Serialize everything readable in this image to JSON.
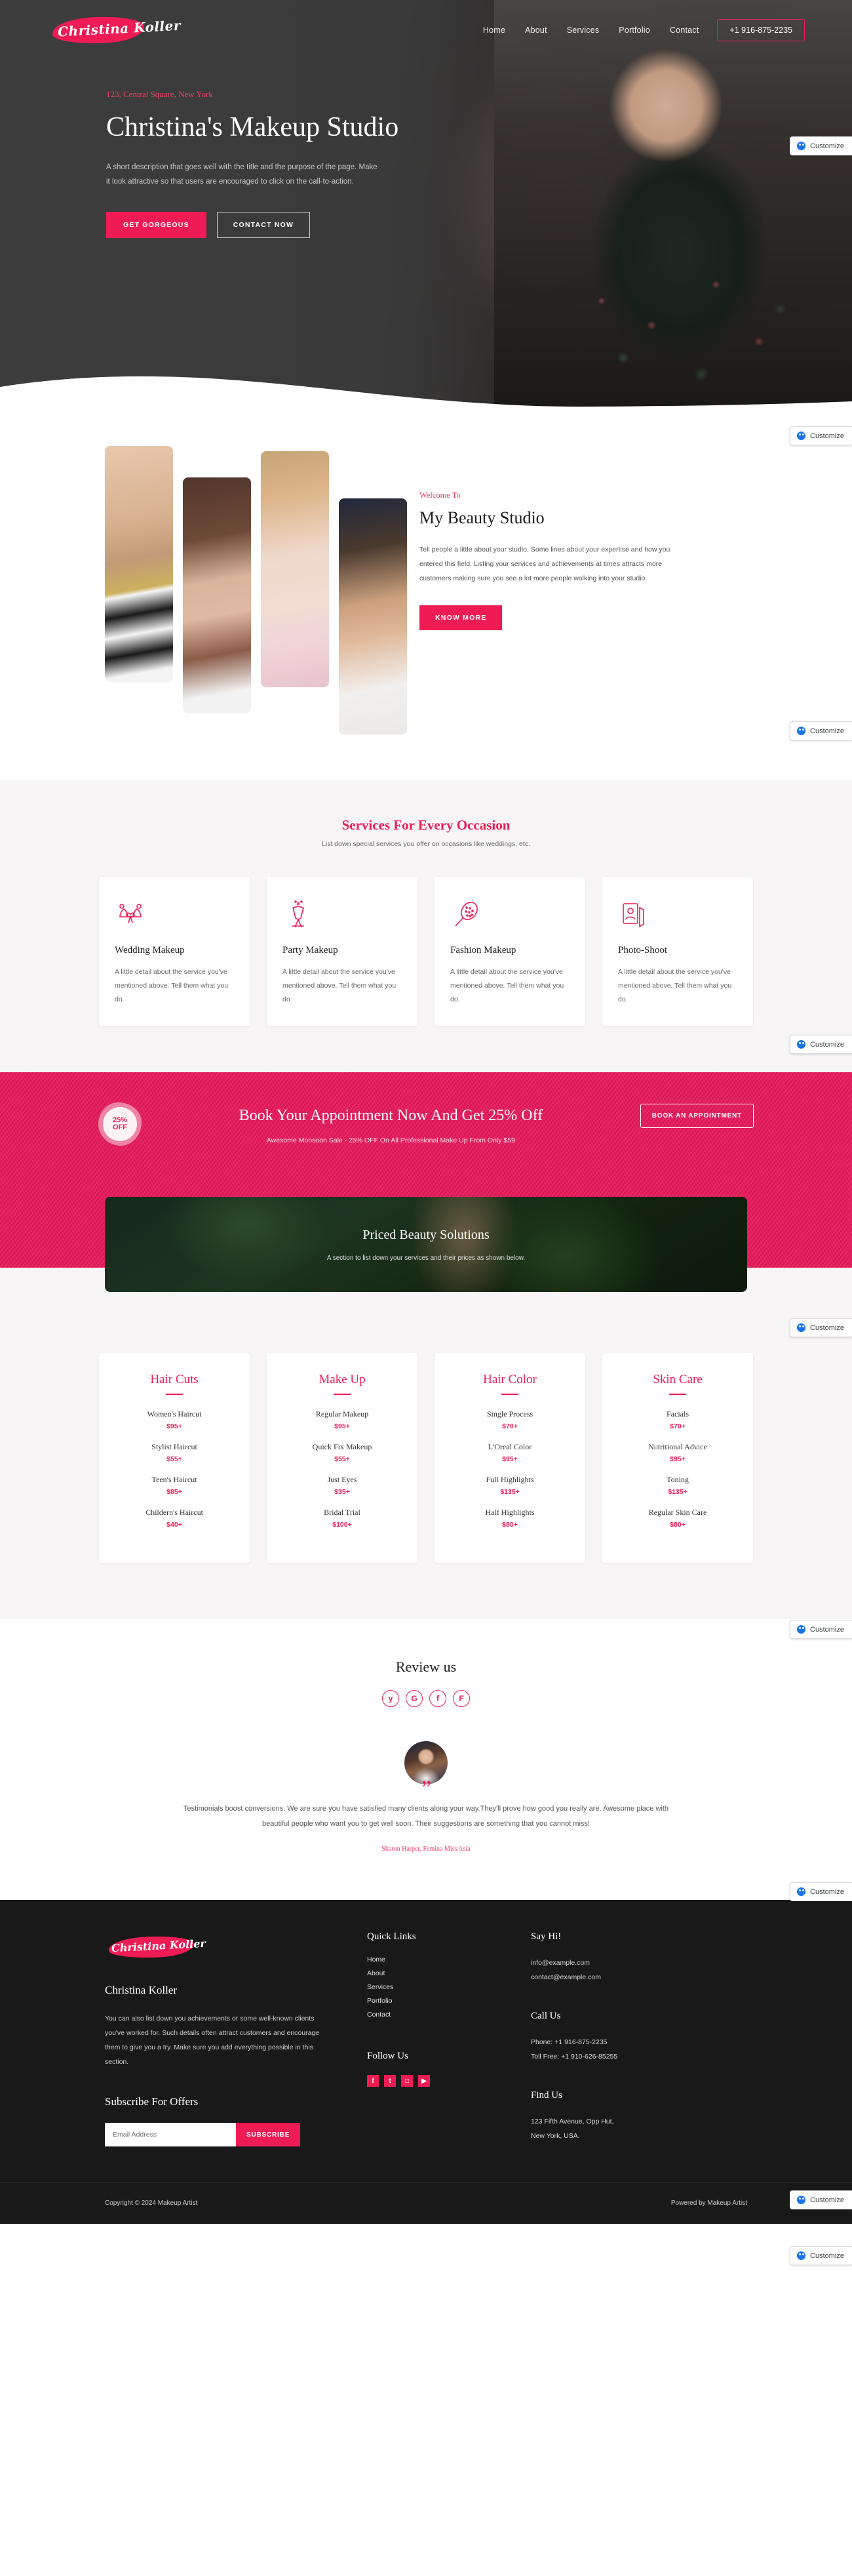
{
  "brand": {
    "logo_text": "Christina Koller"
  },
  "nav": {
    "links": [
      {
        "label": "Home"
      },
      {
        "label": "About"
      },
      {
        "label": "Services"
      },
      {
        "label": "Portfolio"
      },
      {
        "label": "Contact"
      }
    ],
    "phone": "+1 916-875-2235"
  },
  "hero": {
    "address": "123, Central Square, New York",
    "title": "Christina's Makeup Studio",
    "description": "A short description that goes well with the title and the purpose of the page. Make it look attractive so that users are encouraged to click on the call-to-action.",
    "primary_button": "GET GORGEOUS",
    "secondary_button": "CONTACT NOW"
  },
  "customize": {
    "label": "Customize"
  },
  "about": {
    "eyebrow": "Welcome To",
    "heading": "My Beauty Studio",
    "paragraph": "Tell people a little about your studio. Some lines about your expertise and how you entered this field. Listing your services and achievements at times attracts more customers making sure you see a lot more people walking into your studio.",
    "button": "KNOW MORE"
  },
  "services": {
    "title": "Services For Every Occasion",
    "subtitle": "List down special services you offer on occasions like weddings, etc.",
    "items": [
      {
        "icon": "wedding-bells-icon",
        "name": "Wedding Makeup",
        "desc": "A little detail about the service you've mentioned above. Tell them what you do."
      },
      {
        "icon": "champagne-glasses-icon",
        "name": "Party Makeup",
        "desc": "A little detail about the service you've mentioned above. Tell them what you do."
      },
      {
        "icon": "hair-brush-icon",
        "name": "Fashion Makeup",
        "desc": "A little detail about the service you've mentioned above. Tell them what you do."
      },
      {
        "icon": "photo-portrait-icon",
        "name": "Photo-Shoot",
        "desc": "A little detail about the service you've mentioned above. Tell them what you do."
      }
    ]
  },
  "booking": {
    "badge_top": "25%",
    "badge_bottom": "OFF",
    "heading": "Book Your Appointment Now And Get 25% Off",
    "subtext": "Awesome Monsoon Sale - 25% OFF On All Professional Make Up From Only $59",
    "button": "BOOK AN APPOINTMENT"
  },
  "price_hero": {
    "heading": "Priced Beauty Solutions",
    "subtext": "A section to list down your services and their prices as shown below."
  },
  "pricing": {
    "cards": [
      {
        "title": "Hair Cuts",
        "items": [
          {
            "name": "Women's Haircut",
            "price": "$95+"
          },
          {
            "name": "Stylist Haircut",
            "price": "$55+"
          },
          {
            "name": "Teen's Haircut",
            "price": "$85+"
          },
          {
            "name": "Childern's Haircut",
            "price": "$40+"
          }
        ]
      },
      {
        "title": "Make Up",
        "items": [
          {
            "name": "Regular Makeup",
            "price": "$95+"
          },
          {
            "name": "Quick Fix Makeup",
            "price": "$55+"
          },
          {
            "name": "Just Eyes",
            "price": "$35+"
          },
          {
            "name": "Bridal Trial",
            "price": "$100+"
          }
        ]
      },
      {
        "title": "Hair Color",
        "items": [
          {
            "name": "Single Process",
            "price": "$70+"
          },
          {
            "name": "L'Oreal Color",
            "price": "$95+"
          },
          {
            "name": "Full Highlights",
            "price": "$135+"
          },
          {
            "name": "Half Highlights",
            "price": "$80+"
          }
        ]
      },
      {
        "title": "Skin Care",
        "items": [
          {
            "name": "Facials",
            "price": "$70+"
          },
          {
            "name": "Nutritional Advice",
            "price": "$95+"
          },
          {
            "name": "Toning",
            "price": "$135+"
          },
          {
            "name": "Regular Skin Care",
            "price": "$80+"
          }
        ]
      }
    ]
  },
  "review": {
    "heading": "Review us",
    "socials": [
      {
        "icon": "yelp-icon",
        "glyph": "y"
      },
      {
        "icon": "google-icon",
        "glyph": "G"
      },
      {
        "icon": "facebook-icon",
        "glyph": "f"
      },
      {
        "icon": "foursquare-icon",
        "glyph": "F"
      }
    ],
    "quote_mark": "”",
    "testimonial": "Testimonials boost conversions. We are sure you have satisfied many clients along your way.They'll prove how good you really are. Awesome place with beautiful people who want you to get well soon. Their suggestions are something that you cannot miss!",
    "author": "Sharon Harper, Femina Miss Asia"
  },
  "footer": {
    "name": "Christina Koller",
    "about": "You can also list down you achievements or some well-known clients you've worked for. Such details often attract customers and encourage them to give you a try. Make sure you add everything possible in this section.",
    "subscribe_heading": "Subscribe For Offers",
    "email_placeholder": "Email Address",
    "subscribe_button": "SUBSCRIBE",
    "quick_links_heading": "Quick Links",
    "quick_links": [
      {
        "label": "Home"
      },
      {
        "label": "About"
      },
      {
        "label": "Services"
      },
      {
        "label": "Portfolio"
      },
      {
        "label": "Contact"
      }
    ],
    "follow_heading": "Follow Us",
    "socials": [
      {
        "icon": "facebook-icon",
        "glyph": "f"
      },
      {
        "icon": "twitter-icon",
        "glyph": "t"
      },
      {
        "icon": "instagram-icon",
        "glyph": "□"
      },
      {
        "icon": "youtube-icon",
        "glyph": "▶"
      }
    ],
    "say_hi_heading": "Say Hi!",
    "emails": [
      "info@example.com",
      "contact@example.com"
    ],
    "call_heading": "Call Us",
    "phones": [
      "Phone: +1 916-875-2235",
      "Toll Free: +1 910-626-85255"
    ],
    "find_heading": "Find Us",
    "address": [
      "123 Fifth Avenue, Opp Hut,",
      "New York, USA."
    ],
    "copyright": "Copyright © 2024 Makeup Artist",
    "powered": "Powered by Makeup Artist"
  }
}
